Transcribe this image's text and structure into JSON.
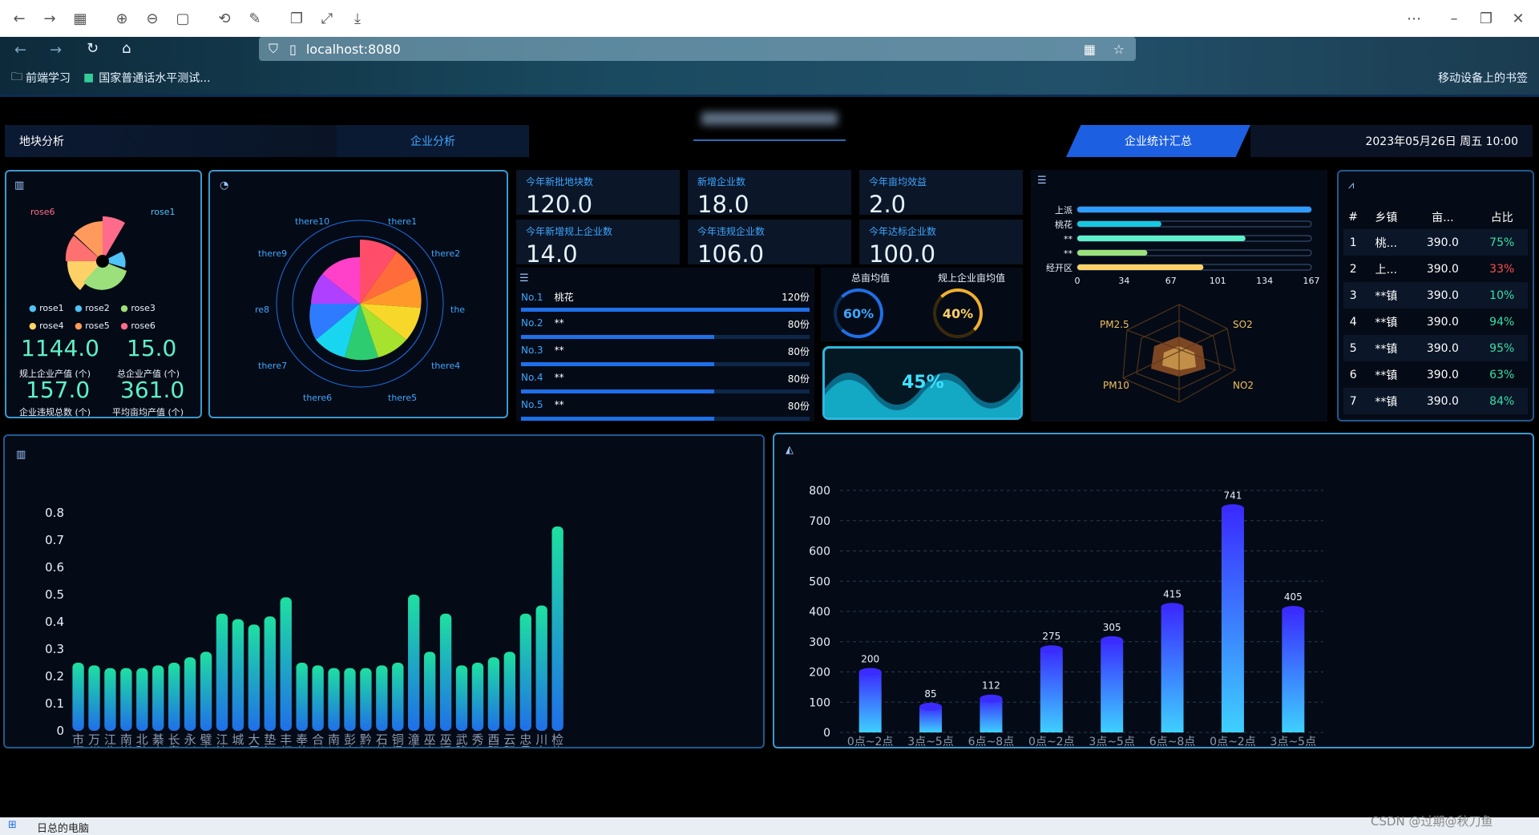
{
  "browser": {
    "address": "localhost:8080",
    "bookmarks": [
      "前端学习",
      "国家普通话水平测试..."
    ],
    "mobile_bookmarks": "移动设备上的书签"
  },
  "header": {
    "tabs": [
      "地块分析",
      "企业分析",
      "企业统计汇总"
    ],
    "datetime": "2023年05月26日 周五 10:00"
  },
  "rose_panel": {
    "legend": [
      "rose1",
      "rose2",
      "rose3",
      "rose4",
      "rose5",
      "rose6"
    ],
    "stats": [
      {
        "value": "1144.0",
        "label": "规上企业产值 (个)"
      },
      {
        "value": "15.0",
        "label": "总企业产值 (个)"
      },
      {
        "value": "157.0",
        "label": "企业违规总数 (个)"
      },
      {
        "value": "361.0",
        "label": "平均亩均产值 (个)"
      }
    ]
  },
  "polar_panel": {
    "labels": [
      "there10",
      "there1",
      "there9",
      "there2",
      "re8",
      "the",
      "there7",
      "there4",
      "there6",
      "there5"
    ]
  },
  "kpis": [
    {
      "label": "今年新批地块数",
      "value": "120.0"
    },
    {
      "label": "新增企业数",
      "value": "18.0"
    },
    {
      "label": "今年亩均效益",
      "value": "2.0"
    },
    {
      "label": "今年新增规上企业数",
      "value": "14.0"
    },
    {
      "label": "今年违规企业数",
      "value": "106.0"
    },
    {
      "label": "今年达标企业数",
      "value": "100.0"
    }
  ],
  "ranking": [
    {
      "no": "No.1",
      "name": "桃花",
      "score": "120份",
      "pct": 1.0
    },
    {
      "no": "No.2",
      "name": "**",
      "score": "80份",
      "pct": 0.67
    },
    {
      "no": "No.3",
      "name": "**",
      "score": "80份",
      "pct": 0.67
    },
    {
      "no": "No.4",
      "name": "**",
      "score": "80份",
      "pct": 0.67
    },
    {
      "no": "No.5",
      "name": "**",
      "score": "80份",
      "pct": 0.67
    }
  ],
  "gauges": {
    "labels": [
      "总亩均值",
      "规上企业亩均值"
    ],
    "values": [
      "60%",
      "40%"
    ],
    "liquid": "45%"
  },
  "hbar_panel": {
    "categories": [
      "上派",
      "桃花",
      "**",
      "**",
      "经开区"
    ],
    "values": [
      167,
      60,
      120,
      50,
      90
    ],
    "ticks": [
      "0",
      "34",
      "67",
      "101",
      "134",
      "167"
    ]
  },
  "radar_panel": {
    "labels": [
      "PM2.5",
      "SO2",
      "PM10",
      "NO2"
    ]
  },
  "table_panel": {
    "headers": [
      "#",
      "乡镇",
      "亩...",
      "占比"
    ],
    "rows": [
      [
        "1",
        "桃...",
        "390.0",
        "75%"
      ],
      [
        "2",
        "上...",
        "390.0",
        "33%"
      ],
      [
        "3",
        "**镇",
        "390.0",
        "10%"
      ],
      [
        "4",
        "**镇",
        "390.0",
        "94%"
      ],
      [
        "5",
        "**镇",
        "390.0",
        "95%"
      ],
      [
        "6",
        "**镇",
        "390.0",
        "63%"
      ],
      [
        "7",
        "**镇",
        "390.0",
        "84%"
      ]
    ],
    "pct_colors": [
      "#36e0a8",
      "#ff4d4f",
      "#36e0a8",
      "#36e0a8",
      "#36e0a8",
      "#36e0a8",
      "#36e0a8"
    ]
  },
  "chart_data": [
    {
      "type": "bar",
      "categories": [
        "市区",
        "万州",
        "江北",
        "南岸",
        "北碚",
        "綦南",
        "长寿",
        "永川",
        "璧山",
        "江津",
        "城口",
        "大足",
        "垫江",
        "丰都",
        "奉节",
        "合川",
        "南川",
        "彭水",
        "黔江",
        "石柱",
        "铜梁",
        "潼南",
        "巫山",
        "巫溪",
        "武隆",
        "秀山",
        "酉阳",
        "云阳",
        "忠县",
        "川东",
        "检修"
      ],
      "values": [
        0.25,
        0.24,
        0.23,
        0.23,
        0.23,
        0.24,
        0.25,
        0.27,
        0.29,
        0.43,
        0.41,
        0.39,
        0.42,
        0.49,
        0.25,
        0.24,
        0.23,
        0.23,
        0.23,
        0.24,
        0.25,
        0.5,
        0.29,
        0.43,
        0.24,
        0.25,
        0.27,
        0.29,
        0.43,
        0.46,
        0.75
      ],
      "ylim": [
        0,
        0.8
      ],
      "yticks": [
        "0",
        "0.1",
        "0.2",
        "0.3",
        "0.4",
        "0.5",
        "0.6",
        "0.7",
        "0.8"
      ]
    },
    {
      "type": "bar",
      "categories": [
        "0点~2点",
        "3点~5点",
        "6点~8点",
        "0点~2点",
        "3点~5点",
        "6点~8点",
        "0点~2点",
        "3点~5点"
      ],
      "values": [
        200,
        85,
        112,
        275,
        305,
        415,
        741,
        405
      ],
      "ylim": [
        0,
        800
      ],
      "yticks": [
        "0",
        "100",
        "200",
        "300",
        "400",
        "500",
        "600",
        "700",
        "800"
      ]
    }
  ],
  "taskbar": {
    "label": "日总的电脑",
    "watermark": "CSDN @过期@秋刀鱼"
  }
}
